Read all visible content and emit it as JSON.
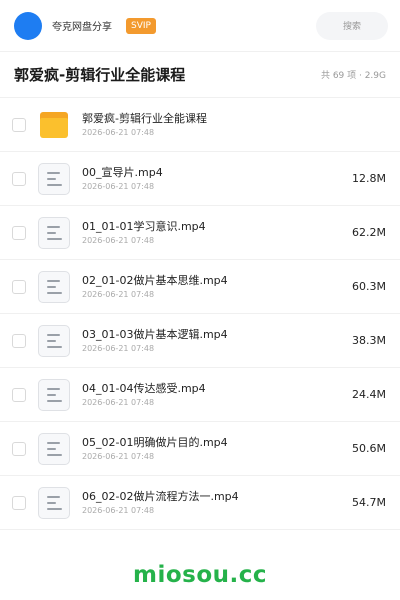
{
  "header": {
    "app_name": "夸克网盘分享",
    "badge": "SVIP",
    "search_label": "搜索",
    "avatar_color": "#1e7df2",
    "badge_color": "#f39a2e"
  },
  "titlebar": {
    "title": "郭爱疯-剪辑行业全能课程",
    "summary": "共 69 项 · 2.9G"
  },
  "files": [
    {
      "name": "郭爱疯-剪辑行业全能课程",
      "date": "2026-06-21 07:48",
      "size": "",
      "type": "folder",
      "icon": "folder-icon"
    },
    {
      "name": "00_宣导片.mp4",
      "date": "2026-06-21 07:48",
      "size": "12.8M",
      "type": "file",
      "icon": "file-icon"
    },
    {
      "name": "01_01-01学习意识.mp4",
      "date": "2026-06-21 07:48",
      "size": "62.2M",
      "type": "file",
      "icon": "file-icon"
    },
    {
      "name": "02_01-02做片基本思维.mp4",
      "date": "2026-06-21 07:48",
      "size": "60.3M",
      "type": "file",
      "icon": "file-icon"
    },
    {
      "name": "03_01-03做片基本逻辑.mp4",
      "date": "2026-06-21 07:48",
      "size": "38.3M",
      "type": "file",
      "icon": "file-icon"
    },
    {
      "name": "04_01-04传达感受.mp4",
      "date": "2026-06-21 07:48",
      "size": "24.4M",
      "type": "file",
      "icon": "file-icon"
    },
    {
      "name": "05_02-01明确做片目的.mp4",
      "date": "2026-06-21 07:48",
      "size": "50.6M",
      "type": "file",
      "icon": "file-icon"
    },
    {
      "name": "06_02-02做片流程方法一.mp4",
      "date": "2026-06-21 07:48",
      "size": "54.7M",
      "type": "file",
      "icon": "file-icon"
    }
  ],
  "watermark": "miosou.cc"
}
